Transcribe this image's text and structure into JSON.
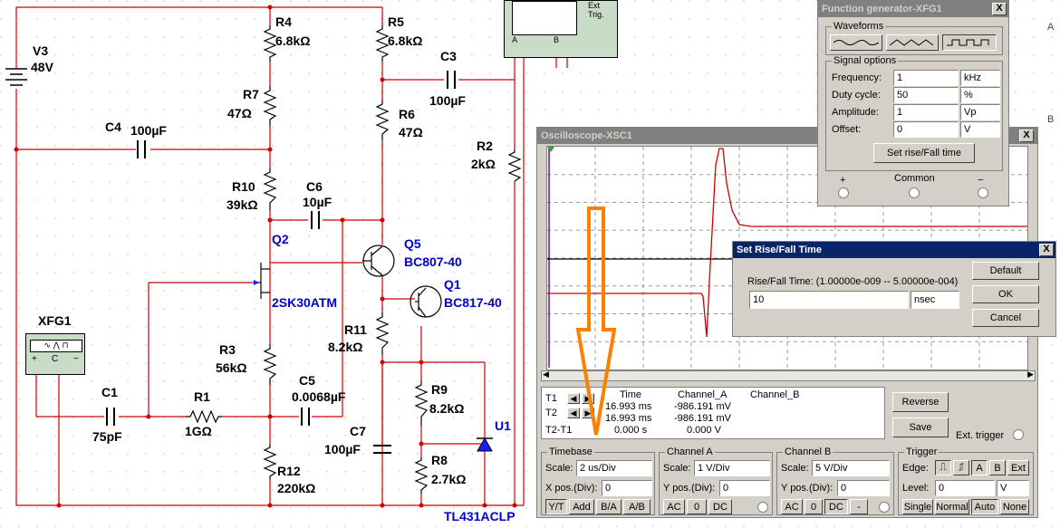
{
  "schematic": {
    "components": [
      {
        "ref": "V3",
        "value": "48V"
      },
      {
        "ref": "R4",
        "value": "6.8kΩ"
      },
      {
        "ref": "R5",
        "value": "6.8kΩ"
      },
      {
        "ref": "C3",
        "value": "100µF"
      },
      {
        "ref": "R7",
        "value": "47Ω"
      },
      {
        "ref": "R6",
        "value": "47Ω"
      },
      {
        "ref": "C4",
        "value": "100µF"
      },
      {
        "ref": "R2",
        "value": "2kΩ"
      },
      {
        "ref": "R10",
        "value": "39kΩ"
      },
      {
        "ref": "C6",
        "value": "10µF"
      },
      {
        "ref": "Q2",
        "value": "2SK30ATM"
      },
      {
        "ref": "Q5",
        "value": "BC807-40"
      },
      {
        "ref": "Q1",
        "value": "BC817-40"
      },
      {
        "ref": "R11",
        "value": "8.2kΩ"
      },
      {
        "ref": "R3",
        "value": "56kΩ"
      },
      {
        "ref": "C1",
        "value": "75pF"
      },
      {
        "ref": "R1",
        "value": "1GΩ"
      },
      {
        "ref": "C5",
        "value": "0.0068µF"
      },
      {
        "ref": "C7",
        "value": "100µF"
      },
      {
        "ref": "R9",
        "value": "8.2kΩ"
      },
      {
        "ref": "U1",
        "value": "TL431ACLP"
      },
      {
        "ref": "R8",
        "value": "2.7kΩ"
      },
      {
        "ref": "R12",
        "value": "220kΩ"
      }
    ],
    "xfg1_label": "XFG1",
    "xfg1_terminals": [
      "+",
      "C",
      "−"
    ],
    "xsc_terminals": {
      "a": "A",
      "b": "B",
      "ext": "Ext Trig."
    },
    "wire_color": "#d00000",
    "right_edge_labels": [
      "A",
      "B"
    ]
  },
  "function_generator": {
    "title": "Function generator-XFG1",
    "waveforms_label": "Waveforms",
    "waveform_icons": [
      "sine-wave-icon",
      "triangle-wave-icon",
      "square-wave-icon"
    ],
    "signal_options_label": "Signal options",
    "rows": [
      {
        "label": "Frequency:",
        "value": "1",
        "unit": "kHz"
      },
      {
        "label": "Duty cycle:",
        "value": "50",
        "unit": "%"
      },
      {
        "label": "Amplitude:",
        "value": "1",
        "unit": "Vp"
      },
      {
        "label": "Offset:",
        "value": "0",
        "unit": "V"
      }
    ],
    "rise_fall_button": "Set rise/Fall time",
    "plus": "+",
    "common": "Common",
    "minus": "−",
    "close": "X"
  },
  "oscilloscope": {
    "title": "Oscilloscope-XSC1",
    "close": "X",
    "readout": {
      "headers": [
        "Time",
        "Channel_A",
        "Channel_B"
      ],
      "t1": {
        "label": "T1",
        "time": "16.993 ms",
        "a": "-986.191 mV",
        "b": ""
      },
      "t2": {
        "label": "T2",
        "time": "16.993 ms",
        "a": "-986.191 mV",
        "b": ""
      },
      "t21": {
        "label": "T2-T1",
        "time": "0.000 s",
        "a": "0.000 V",
        "b": ""
      }
    },
    "reverse": "Reverse",
    "save": "Save",
    "ext_trigger": "Ext. trigger",
    "timebase": {
      "label": "Timebase",
      "scale_label": "Scale:",
      "scale": "2 us/Div",
      "xpos_label": "X pos.(Div):",
      "xpos": "0",
      "buttons": [
        "Y/T",
        "Add",
        "B/A",
        "A/B"
      ]
    },
    "channel_a": {
      "label": "Channel A",
      "scale_label": "Scale:",
      "scale": "1  V/Div",
      "ypos_label": "Y pos.(Div):",
      "ypos": "0",
      "buttons": [
        "AC",
        "0",
        "DC"
      ]
    },
    "channel_b": {
      "label": "Channel B",
      "scale_label": "Scale:",
      "scale": "5  V/Div",
      "ypos_label": "Y pos.(Div):",
      "ypos": "0",
      "buttons": [
        "AC",
        "0",
        "DC",
        "-"
      ]
    },
    "trigger": {
      "label": "Trigger",
      "edge_label": "Edge:",
      "edge_buttons": [
        "A",
        "B",
        "Ext"
      ],
      "level_label": "Level:",
      "level": "0",
      "level_unit": "V",
      "mode_buttons": [
        "Single",
        "Normal",
        "Auto",
        "None"
      ]
    },
    "colors": {
      "channel_a": "#cc0000",
      "trace_black": "#000000",
      "cursor": "#8000c0"
    }
  },
  "rise_fall_dialog": {
    "title": "Set Rise/Fall Time",
    "close": "X",
    "prompt": "Rise/Fall Time: (1.00000e-009 -- 5.00000e-004)",
    "value": "10",
    "unit": "nsec",
    "buttons": [
      "Default",
      "OK",
      "Cancel"
    ]
  },
  "annotation": {
    "type": "down-arrow",
    "color": "#ff8000"
  }
}
